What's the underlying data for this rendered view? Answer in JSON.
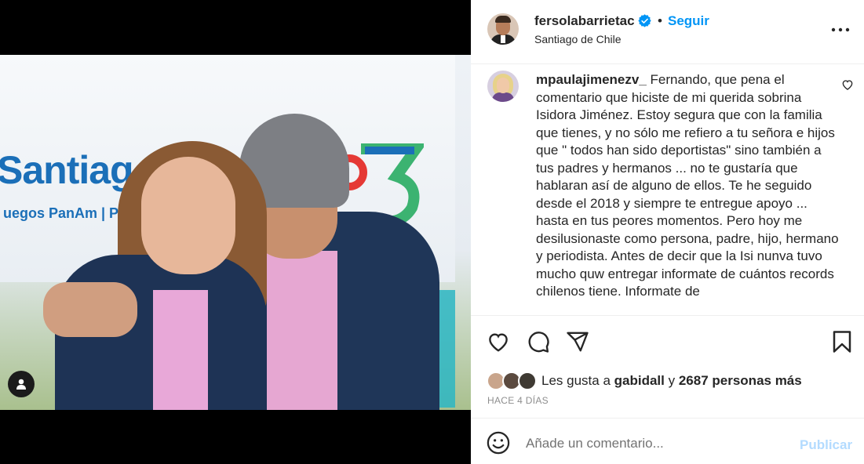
{
  "post": {
    "username": "fersolabarrietac",
    "follow_label": "Seguir",
    "location": "Santiago de Chile",
    "separator": "•"
  },
  "photo": {
    "brand_text": "Santiag",
    "brand_subtitle": "uegos PanAm | Para"
  },
  "comment": {
    "username": "mpaulajimenezv_",
    "text": "Fernando, que pena el comentario que hiciste de mi querida sobrina Isidora Jiménez. Estoy segura que con la familia que tienes, y no sólo me refiero a tu señora e hijos que \" todos han sido deportistas\" sino también a tus padres y hermanos ... no te gustaría que hablaran así de alguno de ellos. Te he seguido desde el 2018 y siempre te entregue apoyo ... hasta en tus peores momentos. Pero hoy me desilusionaste como persona, padre, hijo, hermano y periodista. Antes de decir que la Isi nunva tuvo mucho quw entregar informate de cuántos records chilenos tiene. Informate de"
  },
  "likes": {
    "prefix": "Les gusta a",
    "user": "gabidall",
    "connector": "y",
    "others": "2687 personas más"
  },
  "time_ago": "HACE 4 DÍAS",
  "composer": {
    "placeholder": "Añade un comentario...",
    "publish_label": "Publicar"
  },
  "colors": {
    "accent": "#0095f6",
    "publish_disabled": "#b3dbff",
    "muted": "#8e8e8e"
  },
  "icons": [
    "verified-badge-icon",
    "more-options-icon",
    "heart-icon",
    "comment-icon",
    "share-icon",
    "bookmark-icon",
    "emoji-icon",
    "user-tag-icon"
  ]
}
